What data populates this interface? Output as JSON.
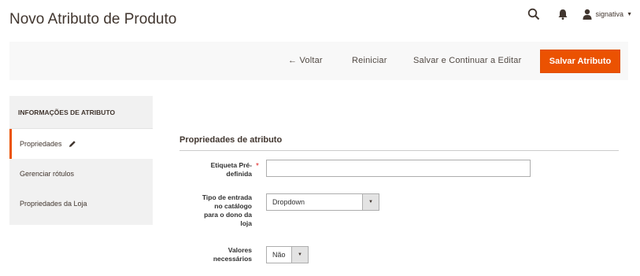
{
  "page": {
    "title": "Novo Atributo de Produto"
  },
  "header": {
    "user_name": "signativa"
  },
  "toolbar": {
    "back_label": "← Voltar",
    "reset_label": "Reiniciar",
    "save_continue_label": "Salvar e Continuar a Editar",
    "save_label": "Salvar Atributo"
  },
  "sidebar": {
    "title": "INFORMAÇÕES DE ATRIBUTO",
    "items": [
      {
        "label": "Propriedades",
        "active": true
      },
      {
        "label": "Gerenciar rótulos",
        "active": false
      },
      {
        "label": "Propriedades da Loja",
        "active": false
      }
    ]
  },
  "form": {
    "section_title": "Propriedades de atributo",
    "default_label": {
      "label_line1": "Etiqueta Pré-",
      "label_line2": "definida",
      "required": "*",
      "value": ""
    },
    "input_type": {
      "label_line1": "Tipo de entrada",
      "label_line2": "no catálogo",
      "label_line3": "para o dono da",
      "label_line4": "loja",
      "value": "Dropdown"
    },
    "required_values": {
      "label_line1": "Valores",
      "label_line2": "necessários",
      "value": "Não"
    }
  },
  "colors": {
    "accent": "#eb5202",
    "toolbar_bg": "#f8f8f8",
    "sidebar_bg": "#f1f1f1"
  }
}
